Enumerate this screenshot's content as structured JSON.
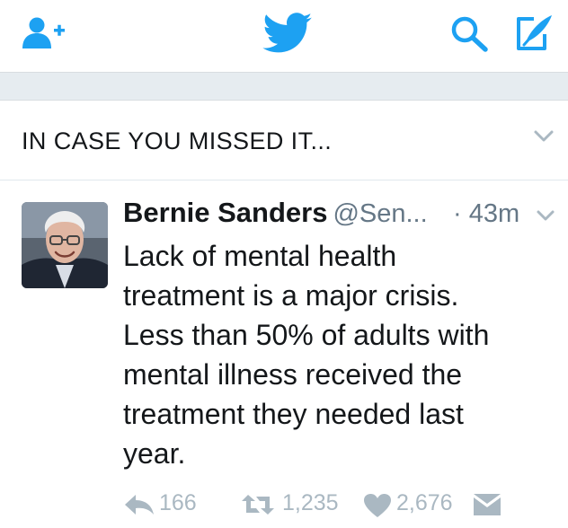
{
  "colors": {
    "brand": "#1da1f2",
    "muted": "#aab8c2",
    "secondary_text": "#657786"
  },
  "header": {
    "icons": [
      "add-user-icon",
      "twitter-bird-icon",
      "search-icon",
      "compose-icon"
    ]
  },
  "section": {
    "title": "IN CASE YOU MISSED IT..."
  },
  "tweet": {
    "author_name": "Bernie Sanders",
    "author_handle": "@Sen...",
    "time": "· 43m",
    "text_lines": [
      "Lack of mental health",
      "treatment is a major crisis.",
      "Less than 50% of adults with",
      "mental illness received the",
      "treatment they needed last",
      "year."
    ],
    "replies": "166",
    "retweets": "1,235",
    "likes": "2,676"
  }
}
